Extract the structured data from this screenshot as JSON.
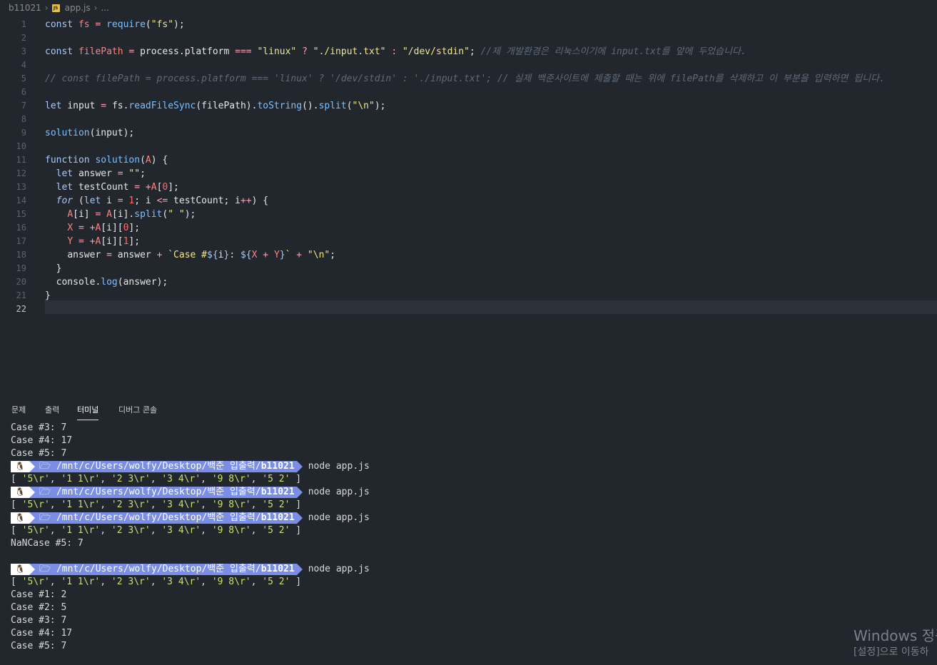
{
  "breadcrumb": {
    "folder": "b11021",
    "file_icon_text": "JS",
    "file": "app.js",
    "more": "..."
  },
  "editor": {
    "current_line": 22,
    "lines": [
      {
        "n": "1"
      },
      {
        "n": "2"
      },
      {
        "n": "3"
      },
      {
        "n": "4"
      },
      {
        "n": "5"
      },
      {
        "n": "6"
      },
      {
        "n": "7"
      },
      {
        "n": "8"
      },
      {
        "n": "9"
      },
      {
        "n": "10"
      },
      {
        "n": "11"
      },
      {
        "n": "12"
      },
      {
        "n": "13"
      },
      {
        "n": "14"
      },
      {
        "n": "15"
      },
      {
        "n": "16"
      },
      {
        "n": "17"
      },
      {
        "n": "18"
      },
      {
        "n": "19"
      },
      {
        "n": "20"
      },
      {
        "n": "21"
      },
      {
        "n": "22"
      }
    ],
    "code": {
      "l1": "const fs = require(\"fs\");",
      "l3": "const filePath = process.platform === \"linux\" ? \"./input.txt\" : \"/dev/stdin\"; //제 개발환경은 리눅스이기에 input.txt를 앞에 두었습니다.",
      "l5": "// const filePath = process.platform === 'linux' ? '/dev/stdin' : './input.txt'; // 실제 백준사이트에 제출할 때는 위에 filePath를 삭제하고 이 부분을 입력하면 됩니다.",
      "l7": "let input = fs.readFileSync(filePath).toString().split(\"\\n\");",
      "l9": "solution(input);",
      "l11": "function solution(A) {",
      "l12": "  let answer = \"\";",
      "l13": "  let testCount = +A[0];",
      "l14": "  for (let i = 1; i <= testCount; i++) {",
      "l15": "    A[i] = A[i].split(\" \");",
      "l16": "    X = +A[i][0];",
      "l17": "    Y = +A[i][1];",
      "l18": "    answer = answer + `Case #${i}: ${X + Y}` + \"\\n\";",
      "l19": "  }",
      "l20": "  console.log(answer);",
      "l21": "}"
    }
  },
  "panel": {
    "tabs": [
      {
        "label": "문제",
        "active": false
      },
      {
        "label": "출력",
        "active": false
      },
      {
        "label": "터미널",
        "active": true
      },
      {
        "label": "디버그 콘솔",
        "active": false
      }
    ]
  },
  "terminal": {
    "prompt_os_icon": "🐧",
    "prompt_path_prefix": "🗁 /mnt/c/Users/wolfy/Desktop/백준 입출력/",
    "prompt_path_dir": "b11021",
    "command": "node app.js",
    "array_output": "[ '5\\r', '1 1\\r', '2 3\\r', '3 4\\r', '9 8\\r', '5 2' ]",
    "lines": {
      "t1": "Case #3: 7",
      "t2": "Case #4: 17",
      "t3": "Case #5: 7",
      "t10": "NaNCase #5: 7",
      "t14": "Case #1: 2",
      "t15": "Case #2: 5",
      "t16": "Case #3: 7",
      "t17": "Case #4: 17",
      "t18": "Case #5: 7"
    }
  },
  "watermark": {
    "line1": "Windows 정품",
    "line2": "[설정]으로 이동하"
  }
}
